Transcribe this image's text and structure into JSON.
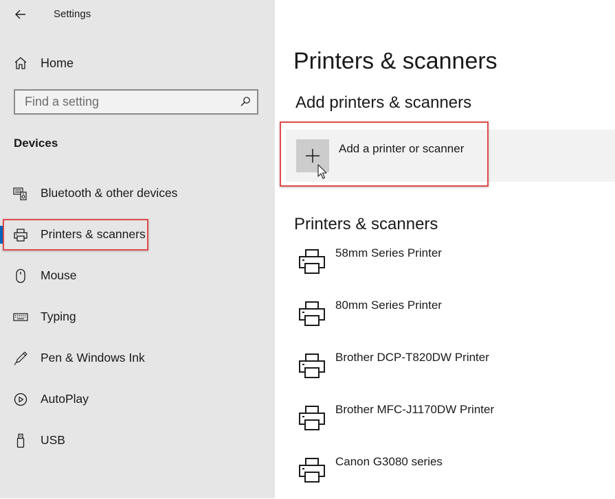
{
  "window": {
    "title": "Settings"
  },
  "sidebar": {
    "home_label": "Home",
    "search": {
      "placeholder": "Find a setting",
      "value": ""
    },
    "group_title": "Devices",
    "items": [
      {
        "label": "Bluetooth & other devices",
        "icon": "bluetooth-devices-icon"
      },
      {
        "label": "Printers & scanners",
        "icon": "printer-icon",
        "selected": true
      },
      {
        "label": "Mouse",
        "icon": "mouse-icon"
      },
      {
        "label": "Typing",
        "icon": "keyboard-icon"
      },
      {
        "label": "Pen & Windows Ink",
        "icon": "pen-icon"
      },
      {
        "label": "AutoPlay",
        "icon": "autoplay-icon"
      },
      {
        "label": "USB",
        "icon": "usb-icon"
      }
    ]
  },
  "main": {
    "page_title": "Printers & scanners",
    "add_section_title": "Add printers & scanners",
    "add_button_label": "Add a printer or scanner",
    "list_section_title": "Printers & scanners",
    "printers": [
      {
        "name": "58mm Series Printer"
      },
      {
        "name": "80mm Series Printer"
      },
      {
        "name": "Brother DCP-T820DW Printer"
      },
      {
        "name": "Brother MFC-J1170DW Printer"
      },
      {
        "name": "Canon G3080 series"
      }
    ]
  },
  "colors": {
    "sidebar_bg": "#e6e6e6",
    "accent": "#0067c0",
    "highlight": "#e04a4a",
    "add_row_bg": "#f2f2f2",
    "plus_tile_bg": "#cccccc"
  }
}
